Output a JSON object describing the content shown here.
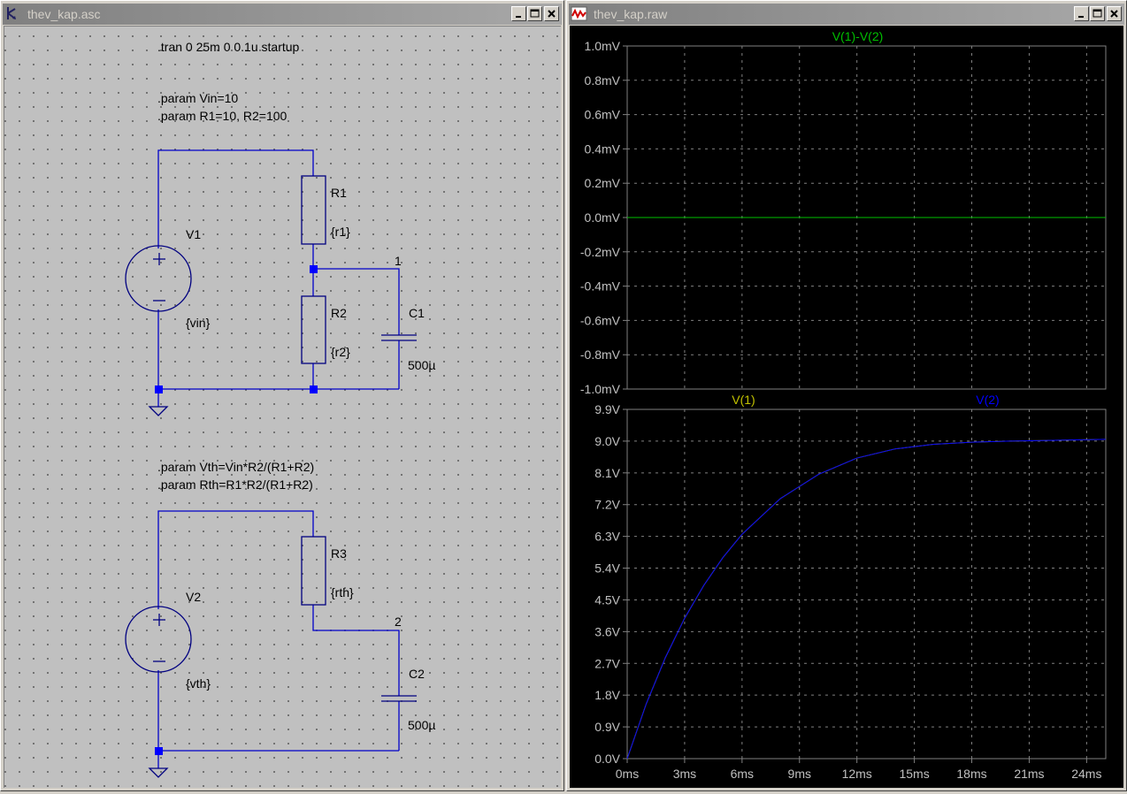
{
  "schematic_window": {
    "title": "thev_kap.asc",
    "directives": {
      "tran": ".tran 0 25m 0 0.1u startup",
      "param1": ".param Vin=10",
      "param2": ".param R1=10, R2=100",
      "param3": ".param Vth=Vin*R2/(R1+R2)",
      "param4": ".param Rth=R1*R2/(R1+R2)"
    },
    "components": {
      "v1": {
        "name": "V1",
        "value": "{vin}"
      },
      "r1": {
        "name": "R1",
        "value": "{r1}"
      },
      "r2": {
        "name": "R2",
        "value": "{r2}"
      },
      "c1": {
        "name": "C1",
        "value": "500µ"
      },
      "v2": {
        "name": "V2",
        "value": "{vth}"
      },
      "r3": {
        "name": "R3",
        "value": "{rth}"
      },
      "c2": {
        "name": "C2",
        "value": "500µ"
      }
    },
    "nets": {
      "net1": "1",
      "net2": "2"
    },
    "colors": {
      "wire": "#0000c8",
      "component": "#000080",
      "junction": "#0000ff",
      "canvas": "#c0c0c0"
    }
  },
  "plot_window": {
    "title": "thev_kap.raw",
    "colors": {
      "background": "#000000",
      "grid": "#808080",
      "axis_text": "#c0c0c0",
      "trace_diff": "#00c000",
      "trace_v1": "#c0c000",
      "trace_v2": "#0000ff"
    }
  },
  "chart_data": [
    {
      "type": "line",
      "title": "",
      "series": [
        {
          "name": "V(1)-V(2)",
          "x": [
            0,
            25
          ],
          "y": [
            0,
            0
          ]
        }
      ],
      "xlabel": "",
      "ylabel": "",
      "xlim": [
        0,
        25
      ],
      "ylim": [
        -1.0,
        1.0
      ],
      "x_unit": "ms",
      "y_unit": "mV",
      "yticks": [
        "1.0mV",
        "0.8mV",
        "0.6mV",
        "0.4mV",
        "0.2mV",
        "0.0mV",
        "-0.2mV",
        "-0.4mV",
        "-0.6mV",
        "-0.8mV",
        "-1.0mV"
      ],
      "grid": true
    },
    {
      "type": "line",
      "title": "",
      "series": [
        {
          "name": "V(1)",
          "x": [
            0,
            1,
            2,
            3,
            4,
            5,
            6,
            8,
            10,
            12,
            14,
            16,
            18,
            20,
            22,
            25
          ],
          "y": [
            0,
            1.56,
            2.87,
            3.98,
            4.91,
            5.7,
            6.36,
            7.37,
            8.06,
            8.52,
            8.78,
            8.91,
            8.97,
            9.0,
            9.02,
            9.05
          ]
        },
        {
          "name": "V(2)",
          "x": [
            0,
            1,
            2,
            3,
            4,
            5,
            6,
            8,
            10,
            12,
            14,
            16,
            18,
            20,
            22,
            25
          ],
          "y": [
            0,
            1.56,
            2.87,
            3.98,
            4.91,
            5.7,
            6.36,
            7.37,
            8.06,
            8.52,
            8.78,
            8.91,
            8.97,
            9.0,
            9.02,
            9.05
          ]
        }
      ],
      "xlabel": "",
      "ylabel": "",
      "xlim": [
        0,
        25
      ],
      "ylim": [
        0,
        9.9
      ],
      "xticks": [
        "0ms",
        "3ms",
        "6ms",
        "9ms",
        "12ms",
        "15ms",
        "18ms",
        "21ms",
        "24ms"
      ],
      "yticks": [
        "9.9V",
        "9.0V",
        "8.1V",
        "7.2V",
        "6.3V",
        "5.4V",
        "4.5V",
        "3.6V",
        "2.7V",
        "1.8V",
        "0.9V",
        "0.0V"
      ],
      "grid": true
    }
  ]
}
